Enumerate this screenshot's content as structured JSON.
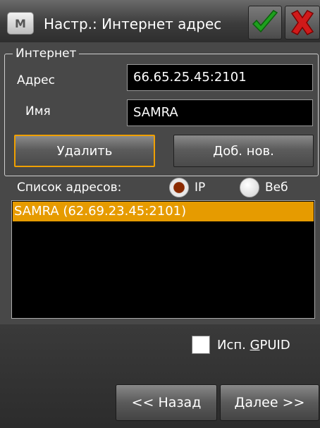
{
  "window": {
    "title": "Настр.: Интернет адрес",
    "app_icon_letter": "M",
    "ok_icon": "checkmark-icon",
    "close_icon": "close-icon"
  },
  "group": {
    "legend": "Интернет",
    "address_label": "Адрес",
    "address_value": "66.65.25.45:2101",
    "name_label": "Имя",
    "name_value": "SAMRA"
  },
  "buttons": {
    "delete": "Удалить",
    "add_new": "Доб. нов."
  },
  "address_list": {
    "label": "Список адресов:",
    "radio_ip": "IP",
    "radio_web": "Веб",
    "selected_mode": "IP",
    "items": [
      "SAMRA (62.69.23.45:2101)"
    ]
  },
  "options": {
    "gpuid_prefix": "Исп. ",
    "gpuid_mnemonic": "G",
    "gpuid_rest": "PUID",
    "gpuid_checked": false
  },
  "nav": {
    "back": "<< Назад",
    "next": "Далее >>"
  },
  "colors": {
    "accent": "#e69b00",
    "panel": "#484848",
    "background": "#000000"
  }
}
